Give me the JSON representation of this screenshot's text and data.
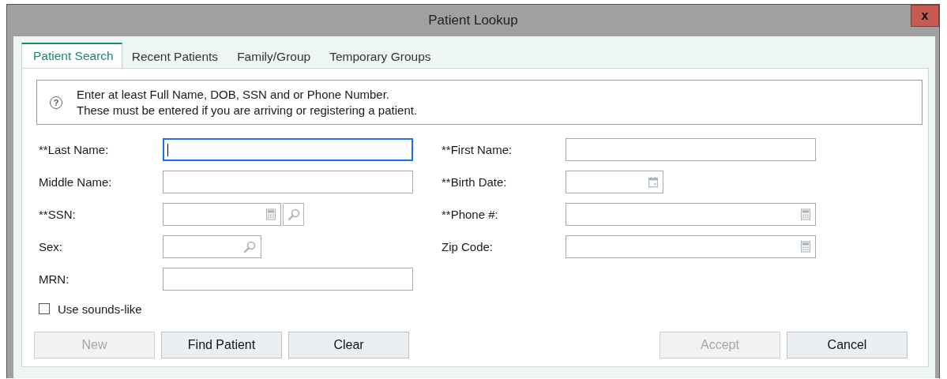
{
  "window": {
    "title": "Patient Lookup",
    "close": "x"
  },
  "tabs": [
    {
      "label": "Patient Search",
      "selected": true
    },
    {
      "label": "Recent Patients",
      "selected": false
    },
    {
      "label": "Family/Group",
      "selected": false
    },
    {
      "label": "Temporary Groups",
      "selected": false
    }
  ],
  "info": {
    "icon": "?",
    "lines": [
      "Enter at least Full Name, DOB, SSN and or Phone Number.",
      "These must be entered if you are arriving or registering a patient."
    ]
  },
  "left_fields": [
    {
      "label": "**Last Name:",
      "kind": "text",
      "focused": true
    },
    {
      "label": "Middle Name:",
      "kind": "text",
      "focused": false
    },
    {
      "label": "**SSN:",
      "kind": "calc-search",
      "focused": false
    },
    {
      "label": "Sex:",
      "kind": "search",
      "focused": false
    },
    {
      "label": "MRN:",
      "kind": "text",
      "focused": false
    }
  ],
  "right_fields": [
    {
      "label": "**First Name:",
      "kind": "text",
      "focused": false
    },
    {
      "label": "**Birth Date:",
      "kind": "date",
      "focused": false
    },
    {
      "label": "**Phone #:",
      "kind": "calc",
      "focused": false
    },
    {
      "label": "Zip Code:",
      "kind": "calc",
      "focused": false
    }
  ],
  "sounds_like": {
    "label": "Use sounds-like",
    "checked": false
  },
  "left_buttons": [
    {
      "label": "New",
      "disabled": true
    },
    {
      "label": "Find Patient",
      "disabled": false
    },
    {
      "label": "Clear",
      "disabled": false
    }
  ],
  "right_buttons": [
    {
      "label": "Accept",
      "disabled": true
    },
    {
      "label": "Cancel",
      "disabled": false
    }
  ]
}
